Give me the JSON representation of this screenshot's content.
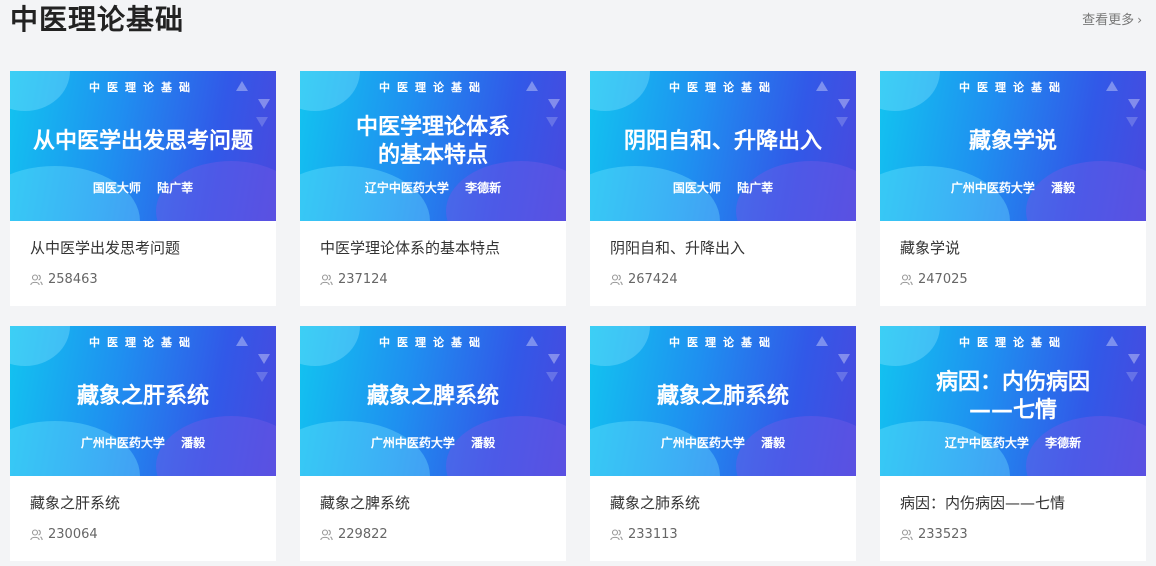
{
  "section": {
    "title": "中医理论基础",
    "more_label": "查看更多"
  },
  "cards": [
    {
      "cover_header": "中医理论基础",
      "cover_title": "从中医学出发思考问题",
      "cover_author": "国医大师  陆广莘",
      "title": "从中医学出发思考问题",
      "views": "258463"
    },
    {
      "cover_header": "中医理论基础",
      "cover_title": "中医学理论体系\n的基本特点",
      "cover_author": "辽宁中医药大学  李德新",
      "title": "中医学理论体系的基本特点",
      "views": "237124"
    },
    {
      "cover_header": "中医理论基础",
      "cover_title": "阴阳自和、升降出入",
      "cover_author": "国医大师  陆广莘",
      "title": "阴阳自和、升降出入",
      "views": "267424"
    },
    {
      "cover_header": "中医理论基础",
      "cover_title": "藏象学说",
      "cover_author": "广州中医药大学  潘毅",
      "title": "藏象学说",
      "views": "247025"
    },
    {
      "cover_header": "中医理论基础",
      "cover_title": "藏象之肝系统",
      "cover_author": "广州中医药大学  潘毅",
      "title": "藏象之肝系统",
      "views": "230064"
    },
    {
      "cover_header": "中医理论基础",
      "cover_title": "藏象之脾系统",
      "cover_author": "广州中医药大学  潘毅",
      "title": "藏象之脾系统",
      "views": "229822"
    },
    {
      "cover_header": "中医理论基础",
      "cover_title": "藏象之肺系统",
      "cover_author": "广州中医药大学  潘毅",
      "title": "藏象之肺系统",
      "views": "233113"
    },
    {
      "cover_header": "中医理论基础",
      "cover_title": "病因：内伤病因\n——七情",
      "cover_author": "辽宁中医药大学  李德新",
      "title": "病因：内伤病因——七情",
      "views": "233523"
    }
  ],
  "colors": {
    "accent_start": "#12c4f0",
    "accent_end": "#4a48de",
    "background": "#f3f4f6"
  },
  "icons": {
    "views": "users-icon",
    "more": "chevron-right-icon"
  }
}
